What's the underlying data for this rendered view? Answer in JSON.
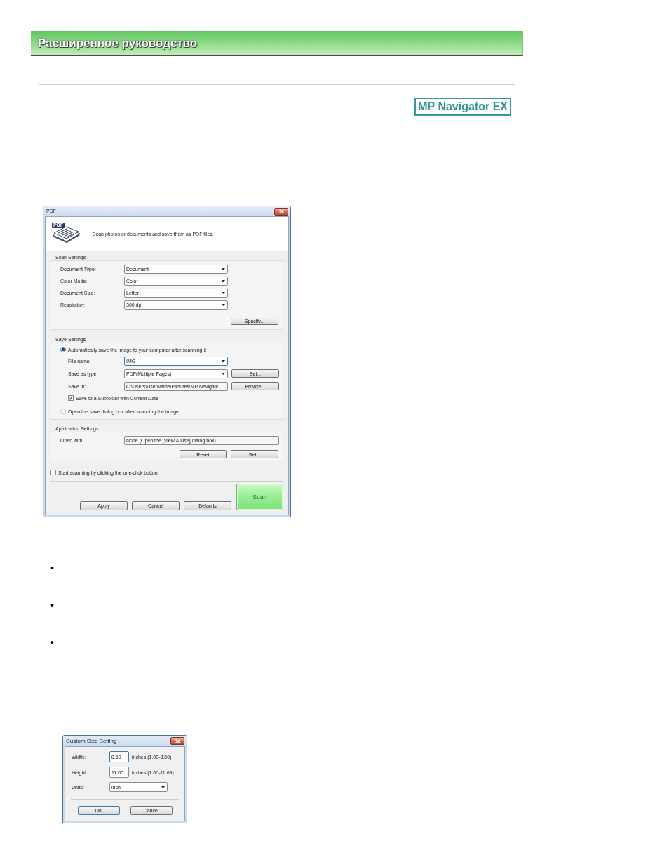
{
  "header": {
    "title": "Расширенное руководство"
  },
  "product": {
    "name": "MP Navigator EX"
  },
  "pdf_dialog": {
    "title": "PDF",
    "icon_tag": "PDF",
    "description": "Scan photos or documents and save them as PDF files.",
    "scan_settings": {
      "label": "Scan Settings",
      "fields": [
        {
          "kind": "combo",
          "label": "Document Type:",
          "value": "Document"
        },
        {
          "kind": "combo",
          "label": "Color Mode:",
          "value": "Color"
        },
        {
          "kind": "combo",
          "label": "Document Size:",
          "value": "Letter"
        },
        {
          "kind": "combo",
          "label": "Resolution:",
          "value": "300 dpi"
        }
      ],
      "button": "Specify..."
    },
    "save_settings": {
      "label": "Save Settings",
      "auto_save": {
        "label": "Automatically save the image to your computer after scanning it",
        "selected": true
      },
      "fields": [
        {
          "kind": "combo",
          "label": "File name:",
          "value": "IMG",
          "focused": true
        },
        {
          "kind": "combo",
          "label": "Save as type:",
          "value": "PDF(Multiple Pages)",
          "focused": false,
          "button": "Set..."
        },
        {
          "kind": "text",
          "label": "Save in:",
          "value": "C:\\Users\\UserName\\Pictures\\MP Navigatc",
          "focused": false,
          "button": "Browse..."
        }
      ],
      "subfolder": {
        "label": "Save to a Subfolder with Current Date",
        "checked": true
      },
      "open_dialog": {
        "label": "Open the save dialog box after scanning the image",
        "selected": false
      }
    },
    "application_settings": {
      "label": "Application Settings",
      "open_with": {
        "kind": "text",
        "label": "Open with:",
        "value": "None (Open the [View & Use] dialog box)"
      },
      "buttons": [
        "Reset",
        "Set..."
      ]
    },
    "one_click": {
      "label": "Start scanning by clicking the one-click button",
      "checked": false
    },
    "buttons": [
      "Apply",
      "Cancel",
      "Defaults"
    ],
    "scan_button": "Scan"
  },
  "bullets": [
    "•",
    "•",
    "•"
  ],
  "custom_size_dialog": {
    "title": "Custom Size Setting",
    "fields": [
      {
        "kind": "input",
        "label": "Width:",
        "value": "8.50",
        "range": "inches (1.00-8.50)",
        "focused": true
      },
      {
        "kind": "input",
        "label": "Height:",
        "value": "11.00",
        "range": "inches (1.00-11.69)",
        "focused": false
      },
      {
        "kind": "combo",
        "label": "Units:",
        "value": "inch",
        "focused": false
      }
    ],
    "buttons": [
      {
        "label": "OK",
        "default": true
      },
      {
        "label": "Cancel",
        "default": false
      }
    ]
  }
}
